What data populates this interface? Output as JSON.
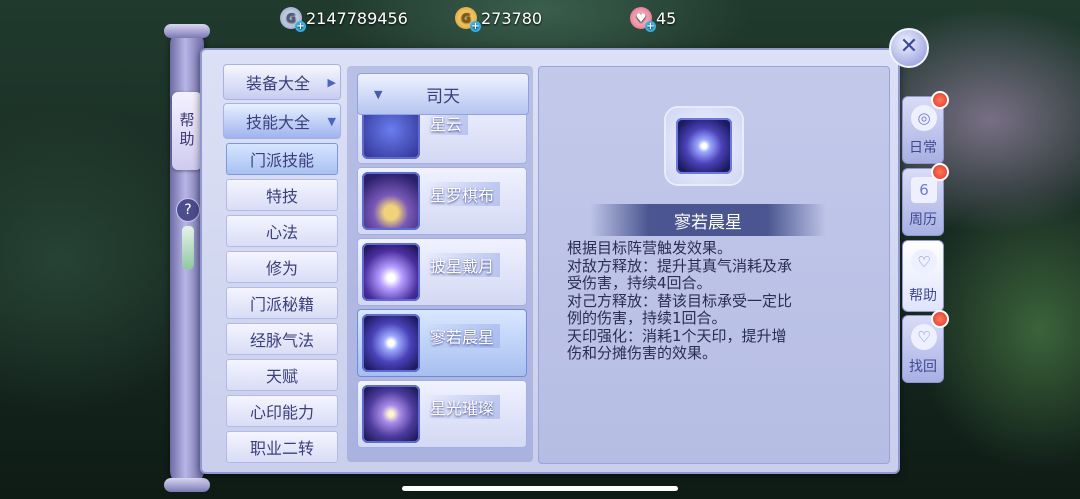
{
  "currency": [
    {
      "icon": "diamond-g-icon",
      "value": "2147789456",
      "color": "#9fb0cf"
    },
    {
      "icon": "gold-coin-icon",
      "value": "273780",
      "color": "#e9b43a"
    },
    {
      "icon": "heart-coin-icon",
      "value": "45",
      "color": "#f06a86"
    }
  ],
  "scroll": {
    "help_tab": "帮助"
  },
  "menu": {
    "categories": [
      {
        "label": "装备大全",
        "arrow": "▶"
      },
      {
        "label": "技能大全",
        "arrow": "▼"
      }
    ],
    "items": [
      "门派技能",
      "特技",
      "心法",
      "修为",
      "门派秘籍",
      "经脉气法",
      "天赋",
      "心印能力",
      "职业二转"
    ],
    "selected": "门派技能"
  },
  "faction": {
    "label": "司天",
    "arrow": "▼"
  },
  "skills": [
    {
      "name": "星云"
    },
    {
      "name": "星罗棋布"
    },
    {
      "name": "披星戴月"
    },
    {
      "name": "寥若晨星",
      "selected": true
    },
    {
      "name": "星光璀璨"
    }
  ],
  "detail": {
    "title": "寥若晨星",
    "lines": [
      "根据目标阵营触发效果。",
      "对敌方释放：提升其真气消耗及承",
      "受伤害，持续4回合。",
      "对己方释放：替该目标承受一定比",
      "例的伤害，持续1回合。",
      "天印强化：消耗1个天印，提升增",
      "伤和分摊伤害的效果。"
    ]
  },
  "right_tabs": [
    {
      "label": "日常",
      "icon": "daily-icon",
      "glyph": "◎"
    },
    {
      "label": "周历",
      "icon": "calendar-icon",
      "glyph": "6"
    },
    {
      "label": "帮助",
      "icon": "help-heart-icon",
      "glyph": "♡"
    },
    {
      "label": "找回",
      "icon": "retrieve-heart-icon",
      "glyph": "♡"
    }
  ],
  "close_label": "✕"
}
